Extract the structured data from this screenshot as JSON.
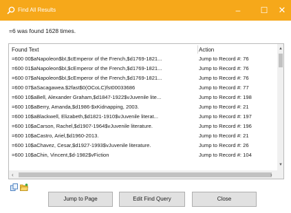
{
  "window": {
    "title": "Find All Results",
    "controls": {
      "minimize": "–",
      "maximize": "☐",
      "close": "✕"
    },
    "accent_color": "#f6a81a"
  },
  "status_text": "=6 was found 1628 times.",
  "table": {
    "columns": [
      "Found Text",
      "Action"
    ],
    "rows": [
      {
        "found": "=600  00$aNapoleon$bI,$cEmperor of the French,$d1769-1821...",
        "action": "Jump to Record #: 76"
      },
      {
        "found": "=600  01$aNapoleon$bI,$cEmperor of the French,$d1769-1821...",
        "action": "Jump to Record #: 76"
      },
      {
        "found": "=600  07$aNapoleon$bI,$cEmperor of the French,$d1769-1821...",
        "action": "Jump to Record #: 76"
      },
      {
        "found": "=600  07$aSacagawea.$2fast$0(OCoLC)fst00033686",
        "action": "Jump to Record #: 77"
      },
      {
        "found": "=600  10$aBell, Alexander Graham,$d1847-1922$vJuvenile lite...",
        "action": "Jump to Record #: 198"
      },
      {
        "found": "=600  10$aBerry, Amanda,$d1986-$xKidnapping, 2003.",
        "action": "Jump to Record #: 21"
      },
      {
        "found": "=600  10$aBlackwell, Elizabeth,$d1821-1910$vJuvenile literat...",
        "action": "Jump to Record #: 197"
      },
      {
        "found": "=600  10$aCarson, Rachel,$d1907-1964$vJuvenile literature.",
        "action": "Jump to Record #: 196"
      },
      {
        "found": "=600  10$aCastro, Ariel,$d1960-2013.",
        "action": "Jump to Record #: 21"
      },
      {
        "found": "=600  10$aChavez, Cesar,$d1927-1993$vJuvenile literature.",
        "action": "Jump to Record #: 26"
      },
      {
        "found": "=600  10$aChin, Vincent,$d-1982$vFiction",
        "action": "Jump to Record #: 104"
      }
    ]
  },
  "scrollbars": {
    "up_arrow": "▲",
    "down_arrow": "▼",
    "left_arrow": "‹",
    "right_arrow": "›"
  },
  "toolbar_icons": [
    "copy-icon",
    "open-folder-icon"
  ],
  "buttons": {
    "jump_to_page": "Jump to Page",
    "edit_find_query": "Edit Find Query",
    "close": "Close"
  }
}
